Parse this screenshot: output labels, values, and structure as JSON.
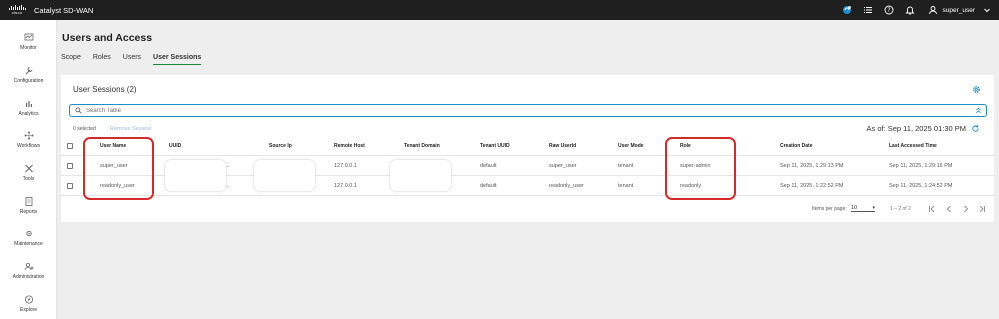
{
  "topbar": {
    "brand": "cisco",
    "app_title": "Catalyst SD-WAN",
    "user": "super_user",
    "icons": [
      "status-icon",
      "list-icon",
      "help-icon",
      "bell-icon",
      "user-icon",
      "chevron-down-icon"
    ]
  },
  "sidebar": {
    "items": [
      {
        "label": "Monitor",
        "icon": "monitor-icon"
      },
      {
        "label": "Configuration",
        "icon": "wrench-icon"
      },
      {
        "label": "Analytics",
        "icon": "bar-chart-icon"
      },
      {
        "label": "Workflows",
        "icon": "workflow-icon"
      },
      {
        "label": "Tools",
        "icon": "tools-icon"
      },
      {
        "label": "Reports",
        "icon": "report-icon"
      },
      {
        "label": "Maintenance",
        "icon": "maintenance-icon"
      },
      {
        "label": "Administration",
        "icon": "admin-icon"
      },
      {
        "label": "Explore",
        "icon": "compass-icon"
      }
    ]
  },
  "page": {
    "title": "Users and Access",
    "tabs": [
      "Scope",
      "Roles",
      "Users",
      "User Sessions"
    ],
    "active_tab": "User Sessions"
  },
  "card": {
    "title": "User Sessions (2)",
    "search_placeholder": "Search Table",
    "selected_count": "0 selected",
    "remove_label": "Remove Session",
    "as_of": "As of: Sep 11, 2025 01:30 PM"
  },
  "table": {
    "columns": [
      "User Name",
      "UUID",
      "Source Ip",
      "Remote Host",
      "Tenant Domain",
      "Tenant UUID",
      "Raw UserId",
      "User Mode",
      "Role",
      "Creation Date",
      "Last Accessed Time"
    ],
    "rows": [
      {
        "user_name": "super_user",
        "uuid_suffix": "...",
        "source_ip": "",
        "remote_host": "127.0.0.1",
        "tenant_domain": "",
        "tenant_uuid": "default",
        "raw_userid": "super_user",
        "user_mode": "tenant",
        "role": "super-admin",
        "creation_date": "Sep 11, 2025, 1:29:13 PM",
        "last_accessed": "Sep 11, 2025, 1:29:16 PM"
      },
      {
        "user_name": "readonly_user",
        "uuid_suffix": "...",
        "source_ip": "",
        "remote_host": "127.0.0.1",
        "tenant_domain": "",
        "tenant_uuid": "default",
        "raw_userid": "readonly_user",
        "user_mode": "tenant",
        "role": "readonly",
        "creation_date": "Sep 11, 2025, 1:22:52 PM",
        "last_accessed": "Sep 11, 2025, 1:24:52 PM"
      }
    ]
  },
  "pagination": {
    "items_per_page_label": "Items per page:",
    "items_per_page": "10",
    "range": "1 – 2 of 2"
  },
  "colors": {
    "accent": "#1990c6",
    "active_tab": "#1a8a3a",
    "highlight": "#d42a2a",
    "topbar": "#1f1f1f"
  }
}
